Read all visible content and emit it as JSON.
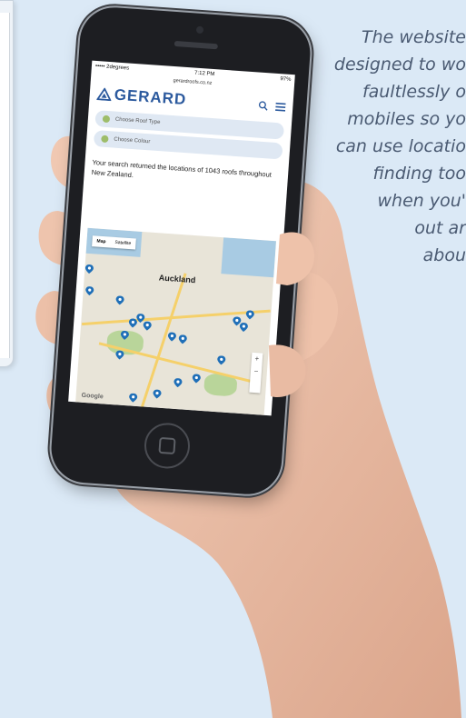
{
  "quote": {
    "lines": [
      "The website",
      "designed to wo",
      "faultlessly o",
      "mobiles so yo",
      "can use locatio",
      "finding too",
      "when you'",
      "out ar",
      "abou"
    ]
  },
  "phone": {
    "status": {
      "carrier": "••••• 2degrees",
      "time": "7:12 PM",
      "battery": "97%"
    },
    "url": "gerardroofs.co.nz",
    "logo": "GERARD",
    "brand_color": "#2c5a9e",
    "filters": [
      {
        "label": "Choose Roof Type"
      },
      {
        "label": "Choose Colour"
      }
    ],
    "result_text": "Your search returned the locations of 1043 roofs throughout New Zealand.",
    "map": {
      "type_buttons": [
        "Map",
        "Satellite"
      ],
      "city_label": "Auckland",
      "zoom_in": "+",
      "zoom_out": "−",
      "attribution": "Google"
    }
  }
}
